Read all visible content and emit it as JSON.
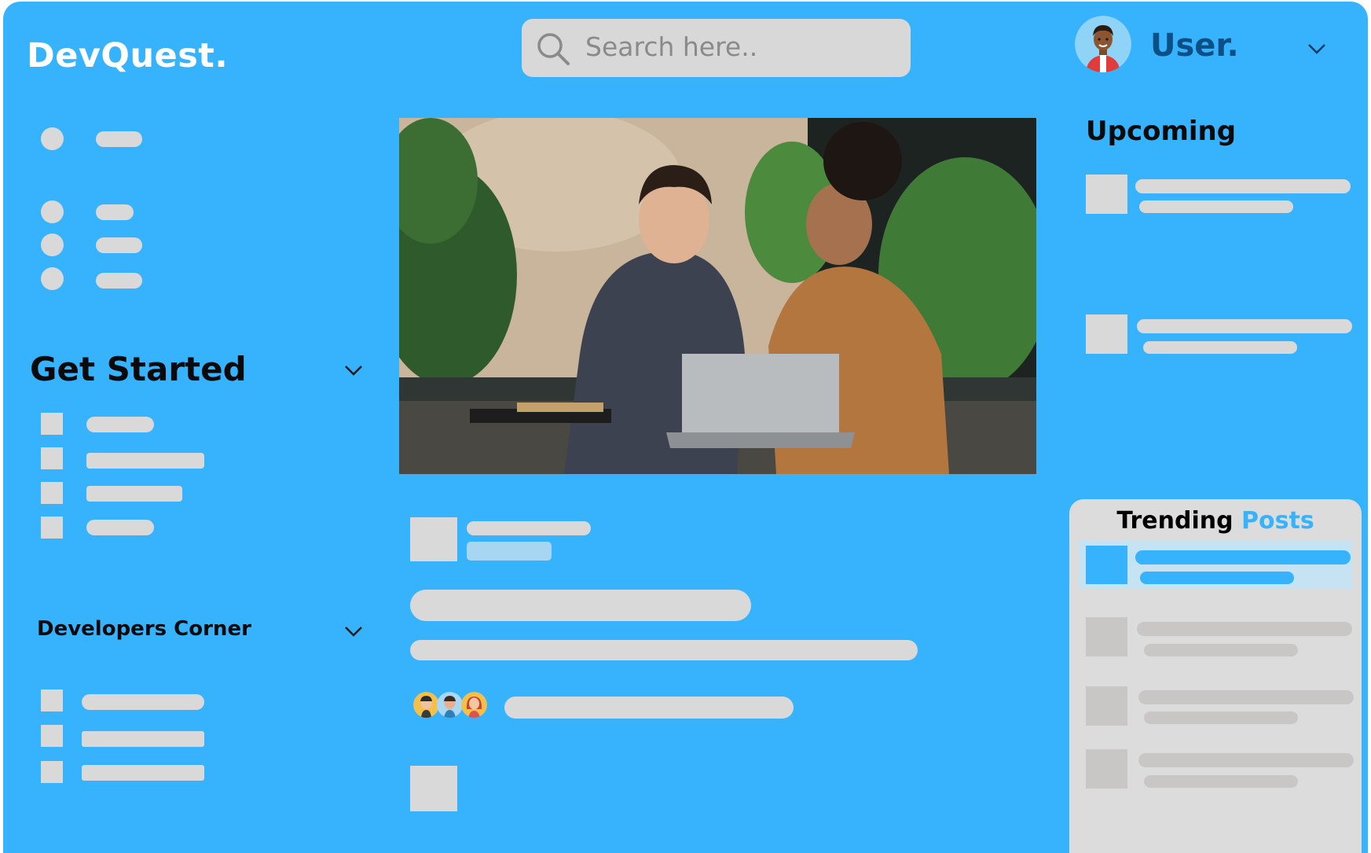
{
  "header": {
    "logo": "DevQuest.",
    "search_placeholder": "Search here..",
    "user_name": "User."
  },
  "sidebar": {
    "get_started_title": "Get Started",
    "developers_corner_title": "Developers Corner"
  },
  "right_panel": {
    "upcoming_title": "Upcoming",
    "trending_word": "Trending",
    "posts_word": "Posts"
  },
  "colors": {
    "background": "#37b3fd",
    "placeholder": "#d9d9d9",
    "user_name": "#0b4f86",
    "trending_panel": "#dcdcdc"
  },
  "icons": {
    "search": "search-icon",
    "user_avatar": "avatar-icon",
    "dropdown": "chevron-down-icon"
  }
}
